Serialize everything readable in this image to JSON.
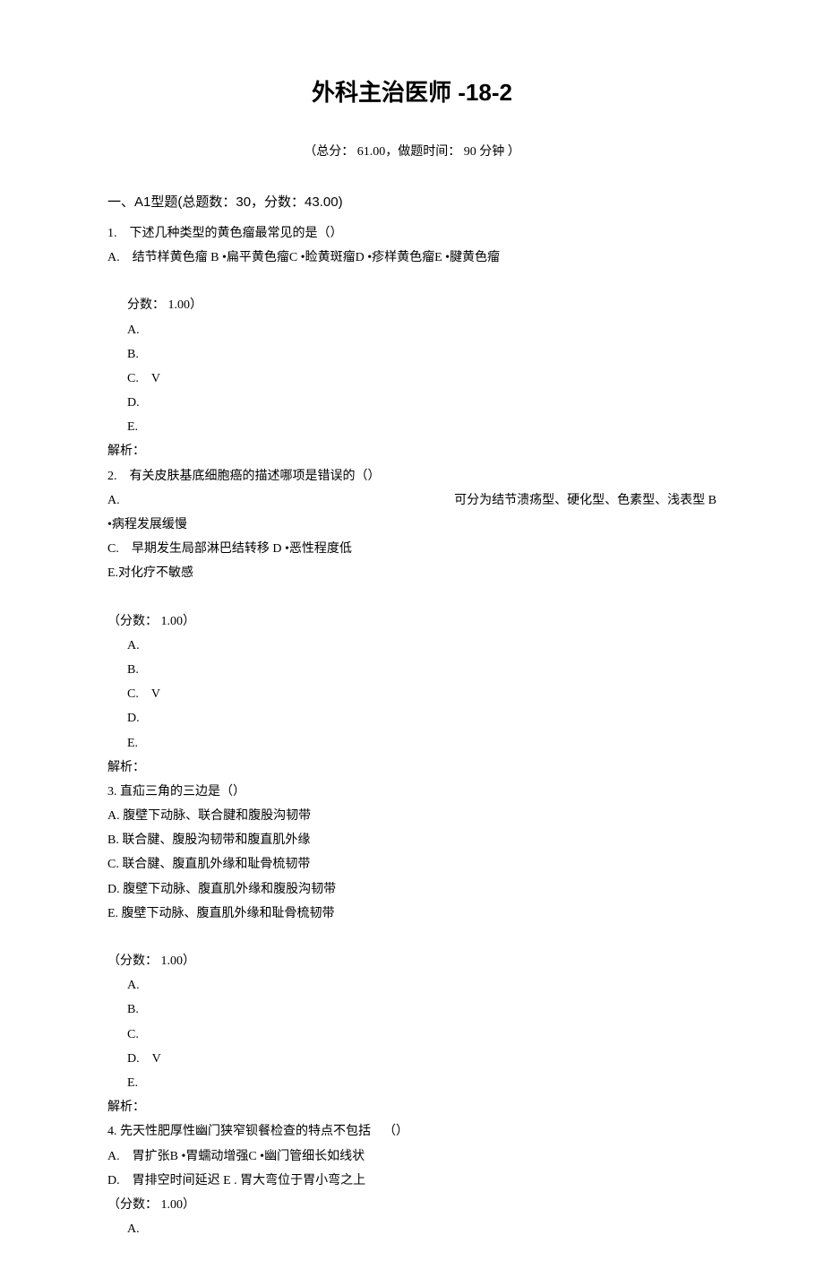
{
  "title": "外科主治医师  -18-2",
  "subtitle": "（总分：  61.00，做题时间：  90 分钟 ）",
  "section_header_prefix": "一、",
  "section_header_type": "A1型题",
  "section_header_stats": "(总题数：30，分数：43.00)",
  "q1": {
    "num": "1.",
    "stem": "下述几种类型的黄色瘤最常见的是（）",
    "options_line": "A. 结节样黄色瘤  B •扁平黄色瘤C •睑黄斑瘤D •疹样黄色瘤E •腱黄色瘤",
    "score": "分数：  1.00）",
    "A": "A.",
    "B": "B.",
    "C": "C. V",
    "D": "D.",
    "E": "E.",
    "analysis": "解析："
  },
  "q2": {
    "num": "2.",
    "stem": "有关皮肤基底细胞癌的描述哪项是错误的（）",
    "lineA": "A.",
    "lineA_right": "可分为结节溃疡型、硬化型、色素型、浅表型   B",
    "lineB": "•病程发展缓慢",
    "lineC": "C. 早期发生局部淋巴结转移  D •恶性程度低",
    "lineE": "E.对化疗不敏感",
    "score": "（分数：  1.00）",
    "A": "A.",
    "B": "B.",
    "C": "C. V",
    "D": "D.",
    "E": "E.",
    "analysis": "解析："
  },
  "q3": {
    "num": "3.",
    "stem": "直疝三角的三边是（）",
    "optA": "A.  腹壁下动脉、联合腱和腹股沟韧带",
    "optB": "B.  联合腱、腹股沟韧带和腹直肌外缘",
    "optC": "C.  联合腱、腹直肌外缘和耻骨梳韧带",
    "optD": "D.  腹壁下动脉、腹直肌外缘和腹股沟韧带",
    "optE": "E.  腹壁下动脉、腹直肌外缘和耻骨梳韧带",
    "score": "（分数：  1.00）",
    "A": "A.",
    "B": "B.",
    "C": "C.",
    "D": "D. V",
    "E": "E.",
    "analysis": "解析："
  },
  "q4": {
    "num": "4.",
    "stem": "先天性肥厚性幽门狭窄钡餐检查的特点不包括 （）",
    "lineA": "A. 胃扩张B •胃蠕动增强C •幽门管细长如线状",
    "lineD": "D. 胃排空时间延迟  E . 胃大弯位于胃小弯之上",
    "score": "（分数：  1.00）",
    "A": "A."
  }
}
